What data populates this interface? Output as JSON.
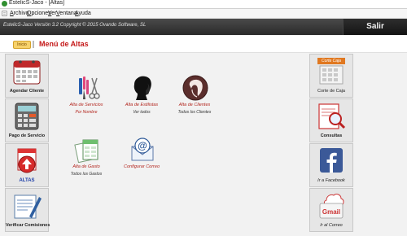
{
  "window": {
    "title": "EstelicS-Jaco - [Altas]"
  },
  "menubar": [
    "Archivo",
    "Opciones",
    "Ver",
    "Ventana",
    "Ayuda"
  ],
  "header": {
    "version": "EstelicS-Jaco Versión 3.2 Copyright © 2015 Ovando Software, SL",
    "exit_label": "Salir"
  },
  "section": {
    "home_label": "Inicio",
    "title": "Menú de Altas"
  },
  "left_tiles": [
    {
      "label": "Agendar Cliente",
      "icon": "calendar-icon"
    },
    {
      "label": "Pago de Servicio",
      "icon": "calculator-icon"
    },
    {
      "label": "ALTAS",
      "icon": "upload-arrow-icon",
      "color": "#1d3fa8"
    },
    {
      "label": "Verificar Comisiones",
      "icon": "document-pen-icon"
    }
  ],
  "right_tiles": [
    {
      "label": "Corte de Caja",
      "icon": "register-icon",
      "banner": "Corte Caja"
    },
    {
      "label": "Consultas",
      "icon": "magnifier-icon"
    },
    {
      "label": "Ir a Facebook",
      "icon": "facebook-icon"
    },
    {
      "label": "Ir al Correo",
      "icon": "gmail-icon"
    }
  ],
  "options": [
    {
      "label": "Alta de Servicios",
      "sub": "Por Nombre",
      "icon": "salon-tools-icon",
      "sub_color": "#b3261e"
    },
    {
      "label": "Alta de Estilistas",
      "sub": "Ver todos",
      "icon": "stylist-silhouette-icon",
      "sub_color": "#333333"
    },
    {
      "label": "Alta de Clientes",
      "sub": "Todos los Clientes",
      "icon": "client-portrait-icon",
      "sub_color": "#333333"
    },
    {
      "label": "Alta de Gasto",
      "sub": "Todos los Gastos",
      "icon": "expense-documents-icon",
      "sub_color": "#333333"
    },
    {
      "label": "Configurar Correo",
      "sub": "",
      "icon": "email-config-icon",
      "sub_color": "#333333"
    }
  ],
  "colors": {
    "accent_red": "#c41818",
    "header_dark": "#2a2a2a",
    "facebook_blue": "#3b5998"
  }
}
